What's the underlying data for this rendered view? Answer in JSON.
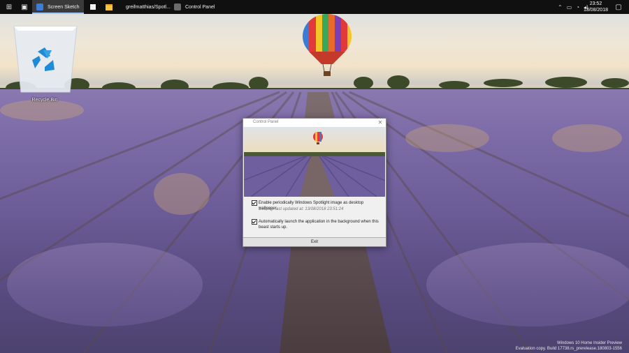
{
  "taskbar": {
    "tasks": [
      {
        "label": "Screen Sketch"
      },
      {
        "label": "greifmatthias/Spotl..."
      },
      {
        "label": "Control Panel"
      }
    ],
    "clock": {
      "time": "23:52",
      "date": "13/08/2018"
    },
    "icons": [
      "start-icon",
      "task-view-icon",
      "sticky-notes-icon",
      "file-explorer-icon",
      "github-icon"
    ]
  },
  "desktop": {
    "recycle_bin": {
      "label": "Recycle Bin"
    },
    "watermark": {
      "line1": "Windows 10 Home Insider Preview",
      "line2": "Evaluation copy. Build 17738.rs_prerelease.180803-1556"
    }
  },
  "window": {
    "title": "Control Panel",
    "options": [
      {
        "label": "Enable periodically Windows Spotlight image as desktop wallpaper.",
        "sub": "Desktop last updated at: 13/08/2018 23:51:24",
        "checked": true
      },
      {
        "label": "Automatically launch the application in the background when this beast starts up.",
        "checked": true
      }
    ],
    "exit_label": "Exit"
  },
  "colors": {
    "taskbar": "#101010",
    "lavender": "#7a6aa6",
    "sky": "#efe6d6"
  }
}
